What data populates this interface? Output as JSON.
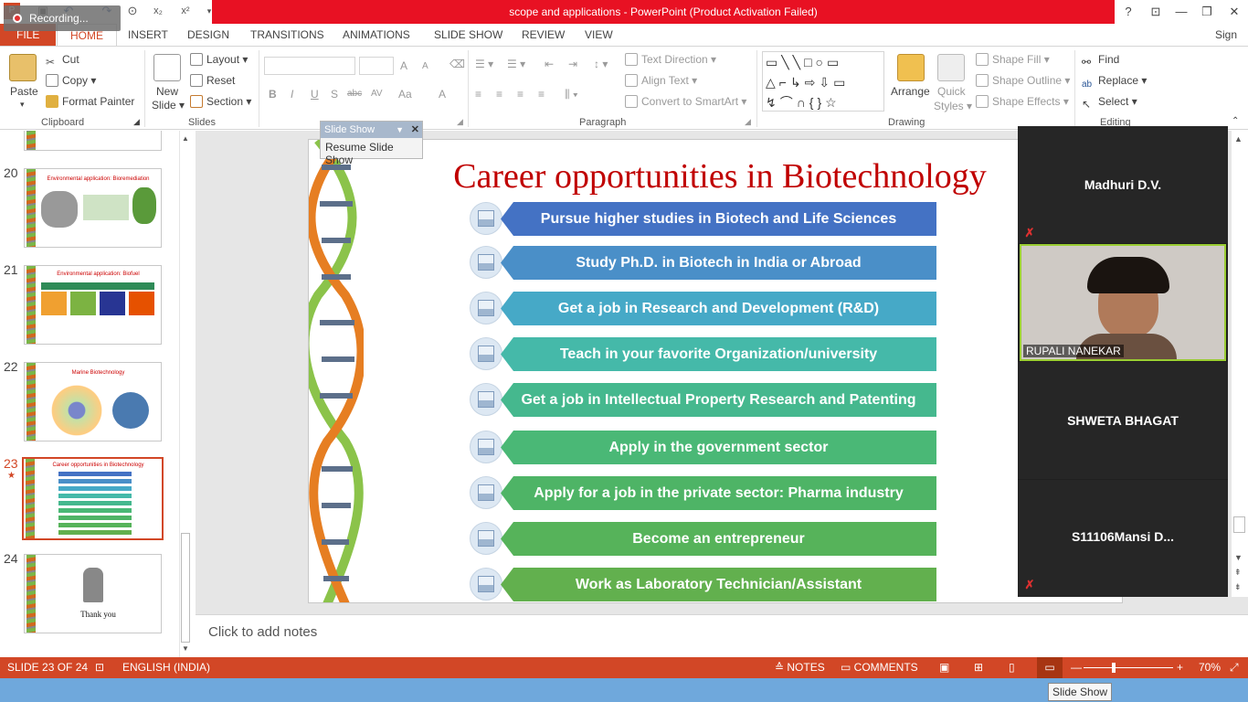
{
  "window": {
    "title": "scope and applications -  PowerPoint (Product Activation Failed)",
    "recording_label": "Recording...",
    "sign_in": "Sign in",
    "help": "?",
    "minimize": "—",
    "maximize": "❐",
    "close": "✕"
  },
  "tabs": [
    "FILE",
    "HOME",
    "INSERT",
    "DESIGN",
    "TRANSITIONS",
    "ANIMATIONS",
    "SLIDE SHOW",
    "REVIEW",
    "VIEW"
  ],
  "ribbon": {
    "clipboard": {
      "paste": "Paste",
      "cut": "Cut",
      "copy": "Copy",
      "format_painter": "Format Painter",
      "label": "Clipboard"
    },
    "slides": {
      "new_slide": "New",
      "new_slide_2": "Slide",
      "layout": "Layout",
      "reset": "Reset",
      "section": "Section",
      "label": "Slides"
    },
    "font": {
      "bold": "B",
      "italic": "I",
      "underline": "U",
      "shadow": "S",
      "strike": "abc",
      "spacing": "AV",
      "case": "Aa",
      "color": "A",
      "grow": "A",
      "shrink": "A"
    },
    "paragraph": {
      "text_direction": "Text Direction",
      "align_text": "Align Text",
      "convert": "Convert to SmartArt",
      "label": "Paragraph"
    },
    "drawing": {
      "arrange": "Arrange",
      "quick_styles": "Quick",
      "quick_styles_2": "Styles",
      "shape_fill": "Shape Fill",
      "shape_outline": "Shape Outline",
      "shape_effects": "Shape Effects",
      "label": "Drawing"
    },
    "editing": {
      "find": "Find",
      "replace": "Replace",
      "select": "Select",
      "label": "Editing"
    }
  },
  "slideshow_toolbar": {
    "title": "Slide Show",
    "resume": "Resume Slide Show"
  },
  "thumbnails": [
    {
      "num": "20",
      "title": "Environmental application: Bioremediation"
    },
    {
      "num": "21",
      "title": "Environmental application: Biofuel"
    },
    {
      "num": "22",
      "title": "Marine Biotechnology"
    },
    {
      "num": "23",
      "title": "Career opportunities in Biotechnology",
      "star": "★"
    },
    {
      "num": "24",
      "title": "Thank you"
    }
  ],
  "slide": {
    "title": "Career opportunities in Biotechnology",
    "items": [
      {
        "text": "Pursue higher studies in Biotech and Life Sciences",
        "color": "#4472c4"
      },
      {
        "text": "Study Ph.D. in Biotech in India or Abroad",
        "color": "#4a8fc8"
      },
      {
        "text": "Get a job in Research and Development (R&D)",
        "color": "#46a9c7"
      },
      {
        "text": "Teach in your favorite Organization/university",
        "color": "#45b9a9"
      },
      {
        "text": "Get a job in Intellectual Property Research and Patenting",
        "color": "#45b88e"
      },
      {
        "text": "Apply in the government sector",
        "color": "#4ab876"
      },
      {
        "text": "Apply for a job in the private sector: Pharma industry",
        "color": "#4eb466"
      },
      {
        "text": "Become an entrepreneur",
        "color": "#56b35a"
      },
      {
        "text": "Work as Laboratory Technician/Assistant",
        "color": "#62b04e"
      }
    ]
  },
  "notes_placeholder": "Click to add notes",
  "participants": [
    {
      "name": "Madhuri D.V."
    },
    {
      "name": "RUPALI NANEKAR"
    },
    {
      "name": "SHWETA BHAGAT"
    },
    {
      "name": "S11106Mansi  D..."
    }
  ],
  "status": {
    "slide_counter": "SLIDE 23 OF 24",
    "language": "ENGLISH (INDIA)",
    "notes": "NOTES",
    "comments": "COMMENTS",
    "zoom": "70%",
    "zoom_level": 0.7
  },
  "tooltip": "Slide Show"
}
